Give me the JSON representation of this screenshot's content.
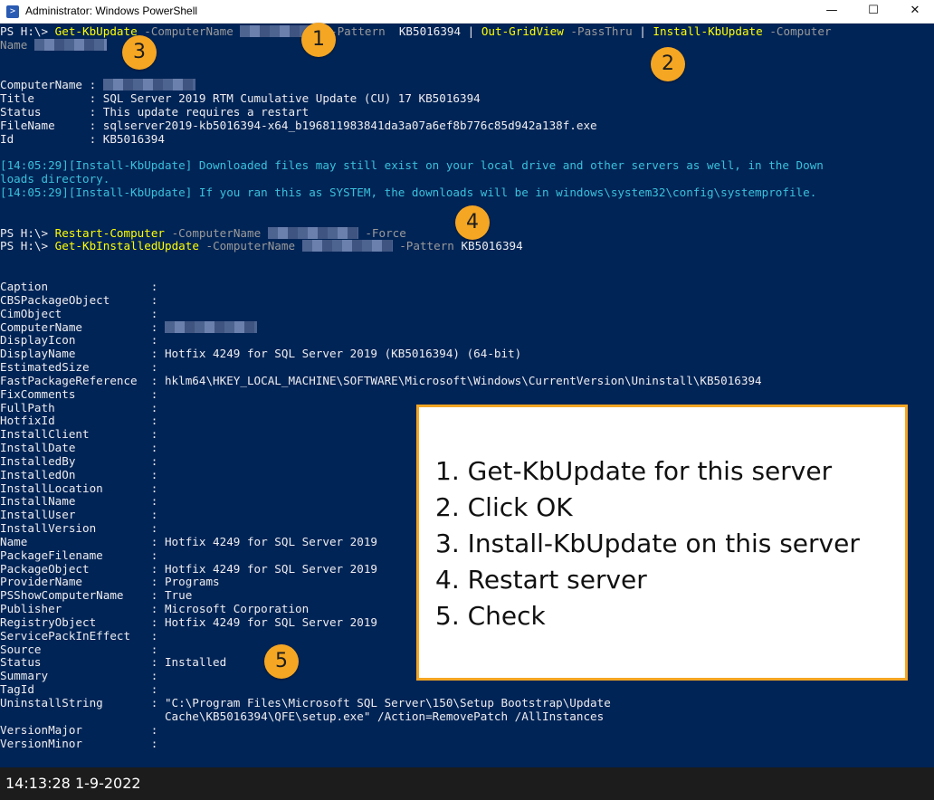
{
  "window": {
    "title": "Administrator: Windows PowerShell",
    "icon": "powershell-icon",
    "controls": {
      "minimize": "—",
      "maximize": "☐",
      "close": "✕"
    }
  },
  "console": {
    "cmd1": {
      "prompt": "PS H:\\> ",
      "cmdlet": "Get-KbUpdate",
      "param1": " -ComputerName ",
      "param2": " -Pattern ",
      "pattern": "KB5016394",
      "pipe1": " | ",
      "cmdlet2": "Out-GridView",
      "param3": " -PassThru",
      "pipe2": " | ",
      "cmdlet3": "Install-KbUpdate",
      "param4": " -Computer",
      "wrap": "Name "
    },
    "result": {
      "computername_key": "ComputerName : ",
      "title": "Title        : SQL Server 2019 RTM Cumulative Update (CU) 17 KB5016394",
      "status": "Status       : This update requires a restart",
      "filename": "FileName     : sqlserver2019-kb5016394-x64_b196811983841da3a07a6ef8b776c85d942a138f.exe",
      "id": "Id           : KB5016394"
    },
    "verbose1": {
      "tag": "[14:05:29][Install-KbUpdate] ",
      "text": "Downloaded files may still exist on your local drive and other servers as well, in the Down",
      "wrap": "loads directory."
    },
    "verbose2": {
      "tag": "[14:05:29][Install-KbUpdate] ",
      "text": "If you ran this as SYSTEM, the downloads will be in windows\\system32\\config\\systemprofile."
    },
    "cmd2": {
      "prompt": "PS H:\\> ",
      "cmdlet": "Restart-Computer",
      "param1": " -ComputerName ",
      "param2": " -Force"
    },
    "cmd3": {
      "prompt": "PS H:\\> ",
      "cmdlet": "Get-KbInstalledUpdate",
      "param1": " -ComputerName ",
      "param2": " -Pattern ",
      "pattern": "KB5016394"
    },
    "props": [
      "Caption               :",
      "CBSPackageObject      :",
      "CimObject             :",
      "ComputerName          :",
      "DisplayIcon           :",
      "DisplayName           : Hotfix 4249 for SQL Server 2019 (KB5016394) (64-bit)",
      "EstimatedSize         :",
      "FastPackageReference  : hklm64\\HKEY_LOCAL_MACHINE\\SOFTWARE\\Microsoft\\Windows\\CurrentVersion\\Uninstall\\KB5016394",
      "FixComments           :",
      "FullPath              :",
      "HotfixId              :",
      "InstallClient         :",
      "InstallDate           :",
      "InstalledBy           :",
      "InstalledOn           :",
      "InstallLocation       :",
      "InstallName           :",
      "InstallUser           :",
      "InstallVersion        :",
      "Name                  : Hotfix 4249 for SQL Server 2019",
      "PackageFilename       :",
      "PackageObject         : Hotfix 4249 for SQL Server 2019",
      "ProviderName          : Programs",
      "PSShowComputerName    : True",
      "Publisher             : Microsoft Corporation",
      "RegistryObject        : Hotfix 4249 for SQL Server 2019",
      "ServicePackInEffect   :",
      "Source                :",
      "Status                : Installed",
      "Summary               :",
      "TagId                 :",
      "UninstallString       : \"C:\\Program Files\\Microsoft SQL Server\\150\\Setup Bootstrap\\Update",
      "                        Cache\\KB5016394\\QFE\\setup.exe\" /Action=RemovePatch /AllInstances",
      "VersionMajor          :",
      "VersionMinor          :"
    ]
  },
  "badges": [
    "1",
    "2",
    "3",
    "4",
    "5"
  ],
  "callout": {
    "steps": [
      "1. Get-KbUpdate for this server",
      "2. Click OK",
      "3. Install-KbUpdate on this server",
      "4. Restart server",
      "5. Check"
    ]
  },
  "statusbar": {
    "clock": "14:13:28 1-9-2022"
  },
  "colors": {
    "console_bg": "#012456",
    "cmdlet": "#ffff00",
    "param": "#9a9a9a",
    "verbose": "#3ac1dc",
    "badge": "#f5a623"
  }
}
